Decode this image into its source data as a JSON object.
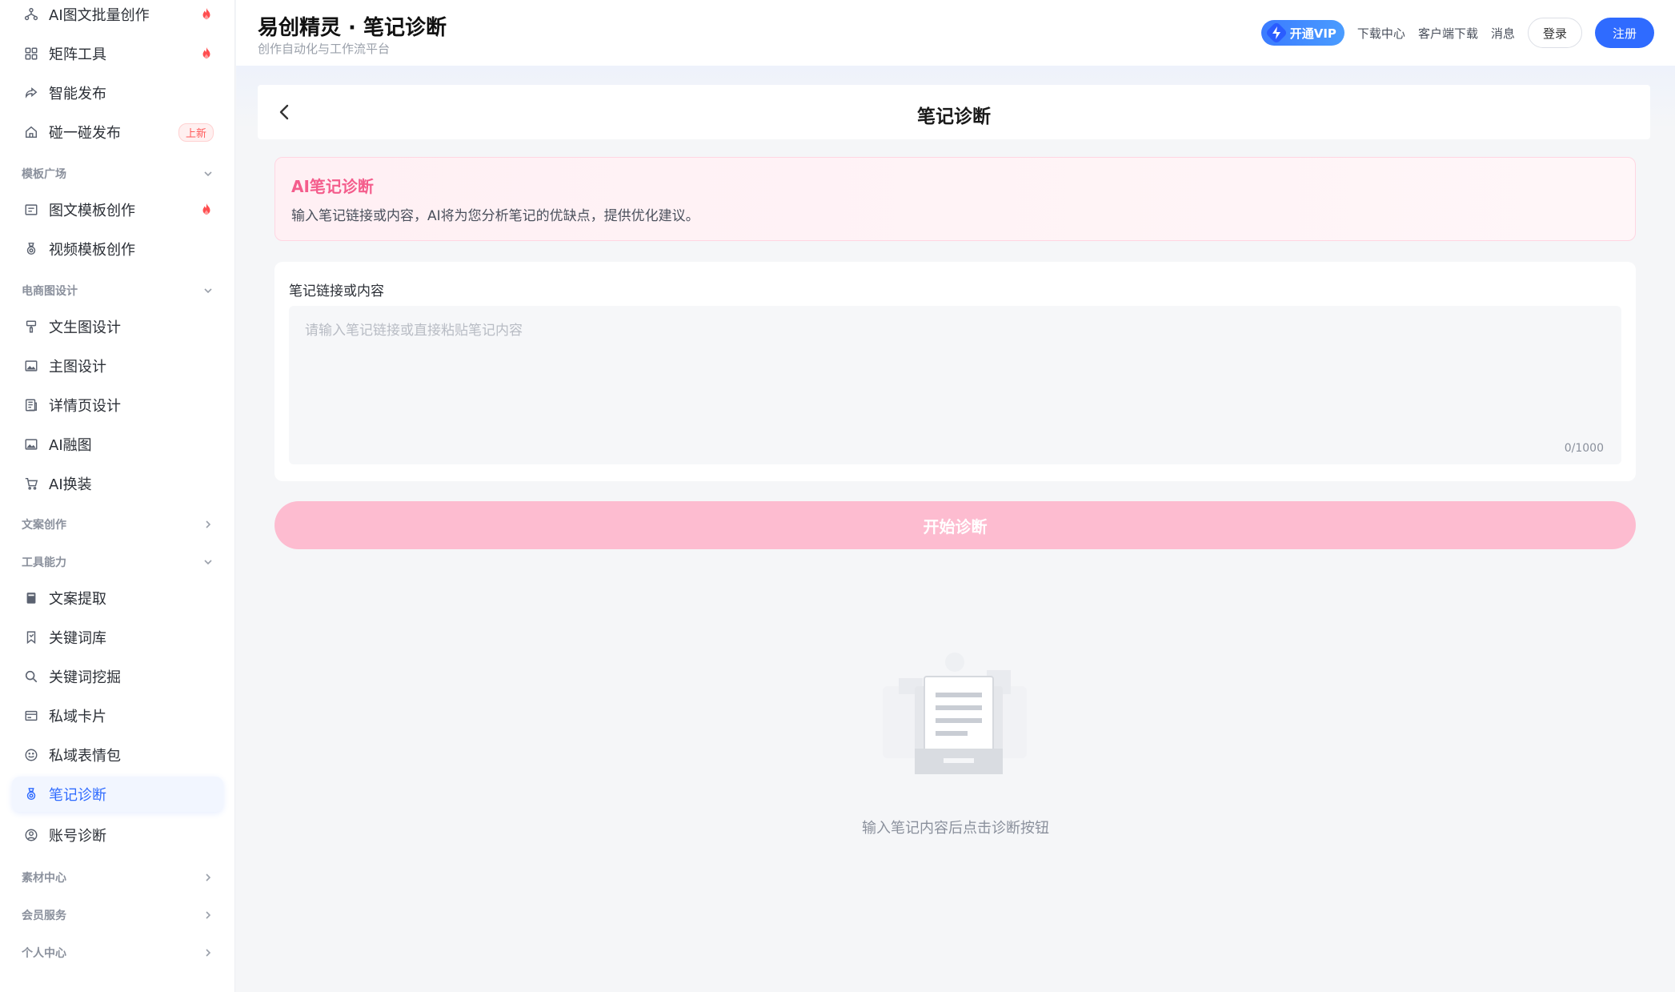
{
  "header": {
    "title": "易创精灵 · 笔记诊断",
    "subtitle": "创作自动化与工作流平台",
    "vip_label": "开通VIP",
    "links": [
      "下载中心",
      "客户端下载",
      "消息"
    ],
    "login_label": "登录",
    "register_label": "注册"
  },
  "sidebar": {
    "items": [
      {
        "label": "AI图文批量创作",
        "icon": "flow-icon",
        "badge": "fire"
      },
      {
        "label": "矩阵工具",
        "icon": "grid-icon",
        "badge": "fire"
      },
      {
        "label": "智能发布",
        "icon": "share-icon"
      },
      {
        "label": "碰一碰发布",
        "icon": "home-icon",
        "tag": "上新"
      }
    ],
    "groups": {
      "templates": {
        "label": "模板广场",
        "expanded": true,
        "items": [
          {
            "label": "图文模板创作",
            "icon": "image-card-icon",
            "badge": "fire"
          },
          {
            "label": "视频模板创作",
            "icon": "medal-icon"
          }
        ]
      },
      "ecommerce": {
        "label": "电商图设计",
        "expanded": true,
        "items": [
          {
            "label": "文生图设计",
            "icon": "brush-icon"
          },
          {
            "label": "主图设计",
            "icon": "picture-icon"
          },
          {
            "label": "详情页设计",
            "icon": "detail-page-icon"
          },
          {
            "label": "AI融图",
            "icon": "picture-icon"
          },
          {
            "label": "AI换装",
            "icon": "cart-icon"
          }
        ]
      },
      "copywriting": {
        "label": "文案创作",
        "expanded": false
      },
      "tools": {
        "label": "工具能力",
        "expanded": true,
        "items": [
          {
            "label": "文案提取",
            "icon": "book-icon"
          },
          {
            "label": "关键词库",
            "icon": "bookmark-icon"
          },
          {
            "label": "关键词挖掘",
            "icon": "search-icon"
          },
          {
            "label": "私域卡片",
            "icon": "card-icon"
          },
          {
            "label": "私域表情包",
            "icon": "smile-icon"
          },
          {
            "label": "笔记诊断",
            "icon": "medal-icon",
            "active": true
          },
          {
            "label": "账号诊断",
            "icon": "user-circle-icon"
          }
        ]
      },
      "materials": {
        "label": "素材中心",
        "expanded": false
      },
      "membership": {
        "label": "会员服务",
        "expanded": false
      },
      "personal": {
        "label": "个人中心",
        "expanded": false
      }
    }
  },
  "main": {
    "page_title": "笔记诊断",
    "info": {
      "title": "AI笔记诊断",
      "desc": "输入笔记链接或内容，AI将为您分析笔记的优缺点，提供优化建议。"
    },
    "field_label": "笔记链接或内容",
    "placeholder": "请输入笔记链接或直接粘贴笔记内容",
    "value": "",
    "counter": "0/1000",
    "start_label": "开始诊断",
    "empty_text": "输入笔记内容后点击诊断按钮"
  },
  "colors": {
    "accent": "#2f6bff",
    "pink": "#f45d8c",
    "start_button": "#fdbcd0"
  }
}
